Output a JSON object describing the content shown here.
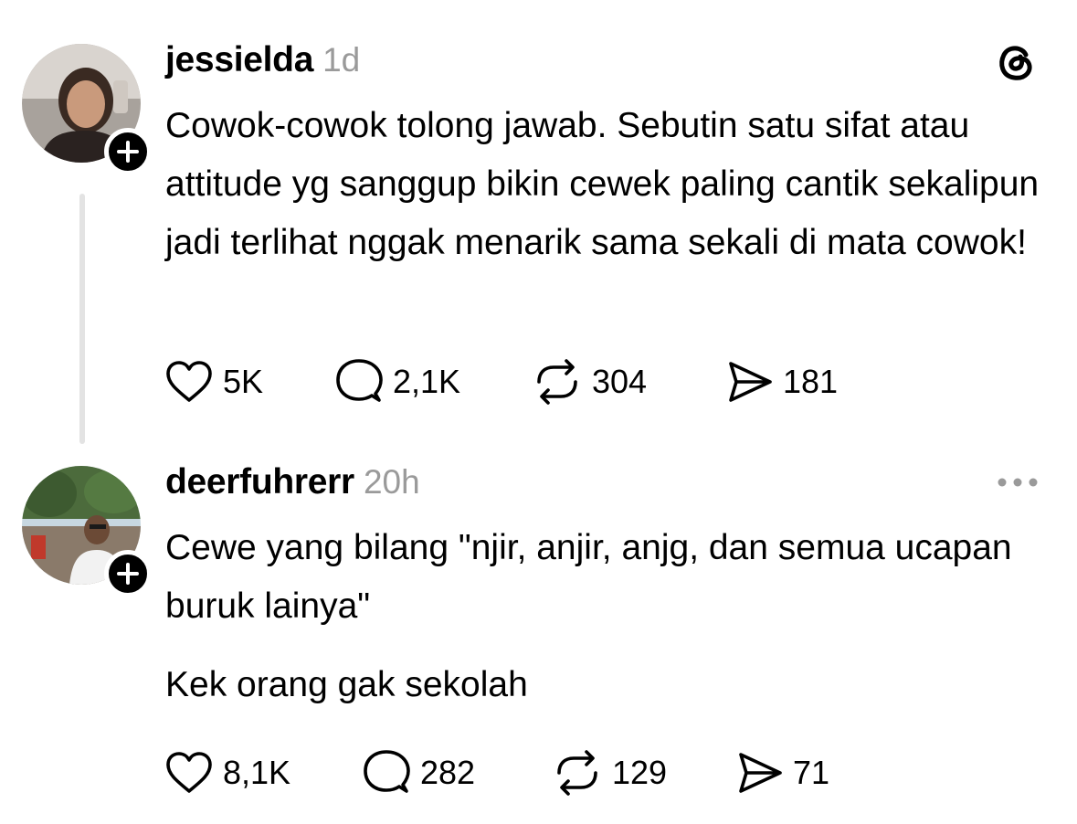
{
  "posts": [
    {
      "username": "jessielda",
      "timestamp": "1d",
      "avatar_icon": "profile-photo",
      "body": "Cowok-cowok tolong jawab. Sebutin satu sifat atau attitude yg sanggup bikin cewek paling cantik sekalipun jadi terlihat nggak menarik sama sekali di mata cowok!",
      "counts": {
        "likes": "5K",
        "replies": "2,1K",
        "reposts": "304",
        "shares": "181"
      }
    },
    {
      "username": "deerfuhrerr",
      "timestamp": "20h",
      "avatar_icon": "profile-photo",
      "body_line1": "Cewe yang bilang \"njir, anjir, anjg, dan semua ucapan buruk lainya\"",
      "body_line2": "Kek orang gak sekolah",
      "counts": {
        "likes": "8,1K",
        "replies": "282",
        "reposts": "129",
        "shares": "71"
      }
    }
  ],
  "icons": {
    "logo": "threads-logo-icon",
    "follow": "plus-icon",
    "more": "more-horizontal-icon",
    "like": "heart-icon",
    "reply": "comment-icon",
    "repost": "repost-icon",
    "share": "send-icon"
  },
  "colors": {
    "text": "#000000",
    "muted": "#9a9a9a",
    "thread_line": "#e3e3e3",
    "background": "#ffffff"
  }
}
